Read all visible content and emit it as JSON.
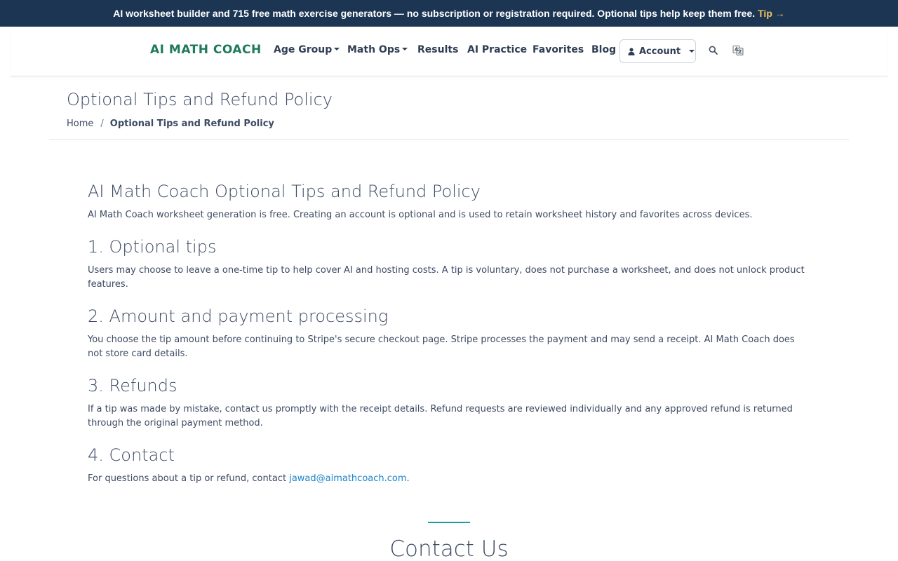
{
  "banner": {
    "message": "AI worksheet builder and 715 free math exercise generators — no subscription or registration required. Optional tips help keep them free.",
    "tip_link": "Tip →",
    "tip_color": "#f0c360",
    "background": "#1b3553"
  },
  "navbar": {
    "brand": "AI MATH COACH",
    "brand_color": "#1f7a5a",
    "items": [
      {
        "label": "Age Group",
        "dropdown": true
      },
      {
        "label": "Math Ops",
        "dropdown": true
      },
      {
        "label": "Results",
        "dropdown": false
      },
      {
        "label": "AI Practice",
        "dropdown": false
      },
      {
        "label": "Favorites",
        "dropdown": false
      },
      {
        "label": "Blog",
        "dropdown": false
      }
    ],
    "account_label": "Account",
    "icons": [
      "user-icon",
      "search-icon",
      "translate-icon"
    ]
  },
  "page": {
    "title": "Optional Tips and Refund Policy",
    "breadcrumb": {
      "home": "Home",
      "separator": "/",
      "current": "Optional Tips and Refund Policy"
    }
  },
  "policy": {
    "heading": "AI Math Coach Optional Tips and Refund Policy",
    "intro": "AI Math Coach worksheet generation is free. Creating an account is optional and is used to retain worksheet history and favorites across devices.",
    "sections": [
      {
        "title": "1. Optional tips",
        "text": "Users may choose to leave a one-time tip to help cover AI and hosting costs. A tip is voluntary, does not purchase a worksheet, and does not unlock product features."
      },
      {
        "title": "2. Amount and payment processing",
        "text": "You choose the tip amount before continuing to Stripe's secure checkout page. Stripe processes the payment and may send a receipt. AI Math Coach does not store card details."
      },
      {
        "title": "3. Refunds",
        "text": "If a tip was made by mistake, contact us promptly with the receipt details. Refund requests are reviewed individually and any approved refund is returned through the original payment method."
      },
      {
        "title": "4. Contact",
        "text_before": "For questions about a tip or refund, contact",
        "email": "jawad@aimathcoach.com",
        "text_after": "."
      }
    ],
    "link_color": "#1a84c7"
  },
  "contact": {
    "title": "Contact Us",
    "accent_color": "#1b9aa8"
  }
}
